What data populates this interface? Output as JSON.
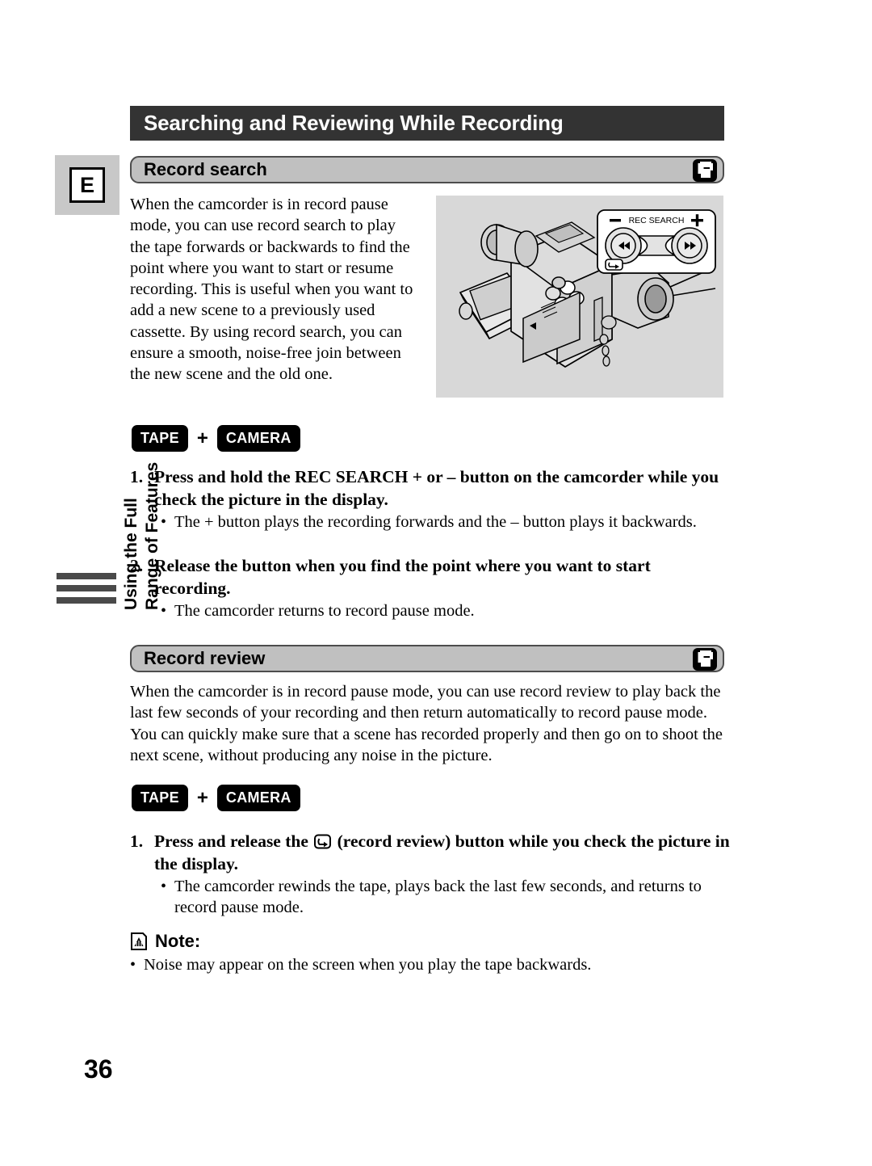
{
  "page": {
    "number": "36",
    "language_tab": "E",
    "sidebar_label_lines": [
      "Using the Full",
      "Range of Features"
    ],
    "title": "Searching and Reviewing While Recording"
  },
  "sections": [
    {
      "id": "record-search",
      "heading": "Record search",
      "heading_icon": "cassette-icon",
      "intro": "When the camcorder is in record pause mode, you can use record search to play the tape forwards or backwards to find the point where you want to start or resume recording. This is useful when you want to add a new scene to a previously used cassette. By using record search, you can ensure a smooth, noise-free join between the new scene and the old one.",
      "modes": {
        "first": "TAPE",
        "operator": "+",
        "second": "CAMERA"
      },
      "steps": [
        {
          "number": "1.",
          "text": "Press and hold the REC SEARCH + or – button on the camcorder while you check the picture in the display.",
          "bullets": [
            "The + button plays the recording forwards and the – button plays it backwards."
          ]
        },
        {
          "number": "2.",
          "text": "Release the button when you find the point where you want to start recording.",
          "bullets": [
            "The camcorder returns to record pause mode."
          ]
        }
      ]
    },
    {
      "id": "record-review",
      "heading": "Record review",
      "heading_icon": "cassette-icon",
      "intro": "When the camcorder is in record pause mode, you can use record review to play back the last few seconds of your recording and then return automatically to record pause mode. You can quickly make sure that a scene has recorded properly and then go on to shoot the next scene, without producing any noise in the picture.",
      "modes": {
        "first": "TAPE",
        "operator": "+",
        "second": "CAMERA"
      },
      "steps": [
        {
          "number": "1.",
          "text_before_icon": "Press and release the ",
          "inline_icon": "record-review-icon",
          "text_after_icon": " (record review) button while you check the picture in the display.",
          "bullets": [
            "The camcorder rewinds the tape, plays back the last few seconds, and returns to record pause mode."
          ]
        }
      ]
    }
  ],
  "note": {
    "icon": "note-icon",
    "label": "Note:",
    "bullets": [
      "Noise may appear on the screen when you play the tape backwards."
    ]
  },
  "illustration": {
    "alt": "camcorder-line-drawing",
    "callout": {
      "minus_label": "–",
      "title": "REC SEARCH",
      "plus_label": "+",
      "left_button": "rewind-icon",
      "right_button": "fast-forward-icon",
      "review_button": "record-review-icon"
    }
  },
  "colors": {
    "title_band": "#333333",
    "section_pill": "#c0c0c0",
    "section_border": "#4d4d4d",
    "illustration_bg": "#d8d8d8",
    "sidebar_bar": "#4a4a4a",
    "lang_tab_bg": "#c8c8c8",
    "badge_bg": "#000000"
  }
}
